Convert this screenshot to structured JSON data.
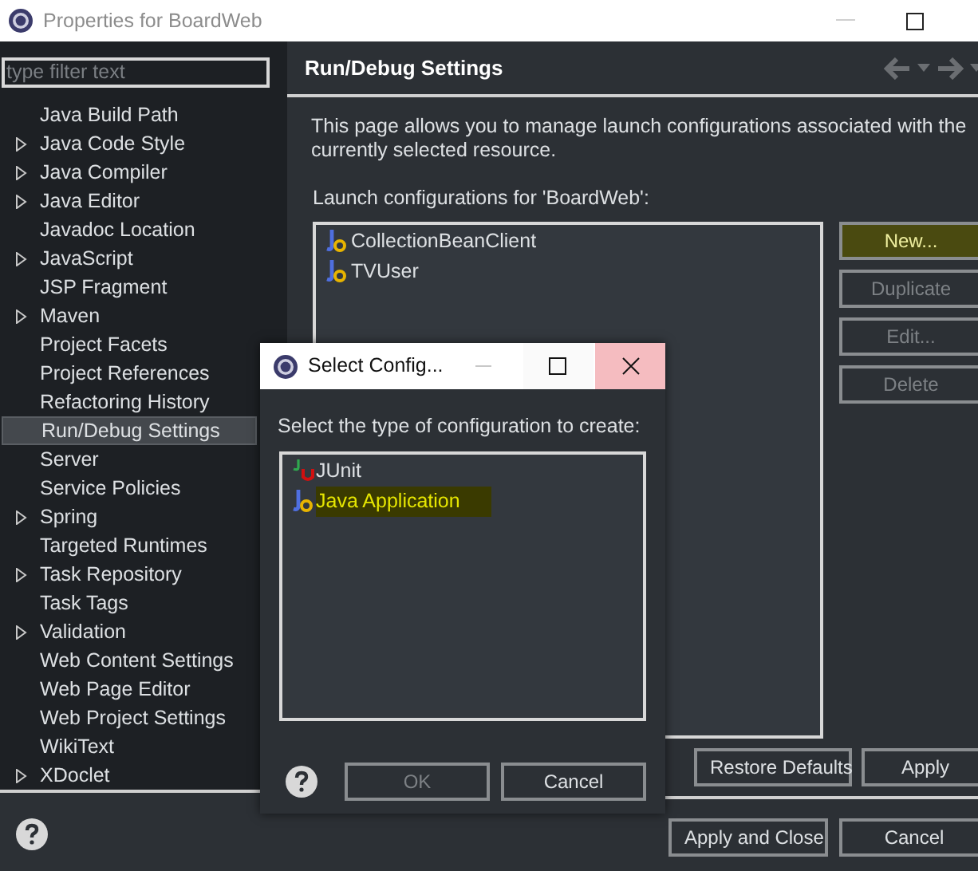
{
  "window": {
    "title": "Properties for BoardWeb"
  },
  "filter": {
    "placeholder": "type filter text"
  },
  "tree": [
    {
      "label": "Java Build Path",
      "expandable": false,
      "selected": false
    },
    {
      "label": "Java Code Style",
      "expandable": true,
      "selected": false
    },
    {
      "label": "Java Compiler",
      "expandable": true,
      "selected": false
    },
    {
      "label": "Java Editor",
      "expandable": true,
      "selected": false
    },
    {
      "label": "Javadoc Location",
      "expandable": false,
      "selected": false
    },
    {
      "label": "JavaScript",
      "expandable": true,
      "selected": false
    },
    {
      "label": "JSP Fragment",
      "expandable": false,
      "selected": false
    },
    {
      "label": "Maven",
      "expandable": true,
      "selected": false
    },
    {
      "label": "Project Facets",
      "expandable": false,
      "selected": false
    },
    {
      "label": "Project References",
      "expandable": false,
      "selected": false
    },
    {
      "label": "Refactoring History",
      "expandable": false,
      "selected": false
    },
    {
      "label": "Run/Debug Settings",
      "expandable": false,
      "selected": true
    },
    {
      "label": "Server",
      "expandable": false,
      "selected": false
    },
    {
      "label": "Service Policies",
      "expandable": false,
      "selected": false
    },
    {
      "label": "Spring",
      "expandable": true,
      "selected": false
    },
    {
      "label": "Targeted Runtimes",
      "expandable": false,
      "selected": false
    },
    {
      "label": "Task Repository",
      "expandable": true,
      "selected": false
    },
    {
      "label": "Task Tags",
      "expandable": false,
      "selected": false
    },
    {
      "label": "Validation",
      "expandable": true,
      "selected": false
    },
    {
      "label": "Web Content Settings",
      "expandable": false,
      "selected": false
    },
    {
      "label": "Web Page Editor",
      "expandable": false,
      "selected": false
    },
    {
      "label": "Web Project Settings",
      "expandable": false,
      "selected": false
    },
    {
      "label": "WikiText",
      "expandable": false,
      "selected": false
    },
    {
      "label": "XDoclet",
      "expandable": true,
      "selected": false
    }
  ],
  "page": {
    "title": "Run/Debug Settings",
    "description": "This page allows you to manage launch configurations associated with the currently selected resource.",
    "list_label": "Launch configurations for 'BoardWeb':",
    "configurations": [
      {
        "label": "CollectionBeanClient"
      },
      {
        "label": "TVUser"
      }
    ],
    "side_buttons": [
      {
        "label": "New...",
        "disabled": false,
        "highlighted": true
      },
      {
        "label": "Duplicate",
        "disabled": true,
        "highlighted": false
      },
      {
        "label": "Edit...",
        "disabled": true,
        "highlighted": false
      },
      {
        "label": "Delete",
        "disabled": true,
        "highlighted": false
      }
    ],
    "bottom_buttons": [
      "Restore Defaults",
      "Apply"
    ]
  },
  "footer_buttons": [
    {
      "label": "Apply and Close",
      "default": true
    },
    {
      "label": "Cancel",
      "default": false
    }
  ],
  "dialog": {
    "title": "Select Config...",
    "prompt": "Select the type of configuration to create:",
    "types": [
      {
        "label": "JUnit",
        "kind": "junit",
        "highlighted": false
      },
      {
        "label": "Java Application",
        "kind": "java",
        "highlighted": true
      }
    ],
    "buttons": [
      {
        "label": "OK",
        "disabled": true
      },
      {
        "label": "Cancel",
        "disabled": false
      }
    ]
  }
}
